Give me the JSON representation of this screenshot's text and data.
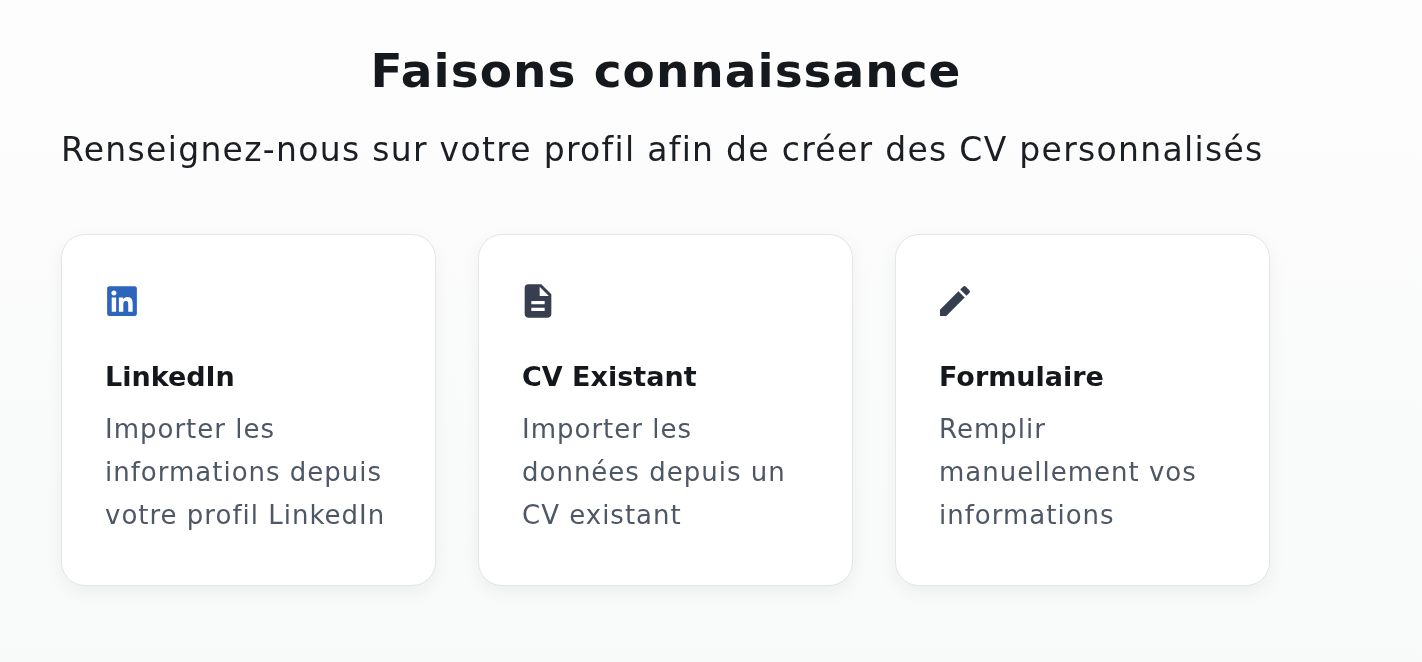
{
  "heading": {
    "title": "Faisons connaissance",
    "subtitle": "Renseignez-nous sur votre profil afin de créer des CV personnalisés"
  },
  "options": [
    {
      "kind": "linkedin",
      "title": "LinkedIn",
      "description": "Importer les informations depuis votre profil LinkedIn"
    },
    {
      "kind": "document",
      "title": "CV Existant",
      "description": "Importer les données depuis un CV existant"
    },
    {
      "kind": "pencil",
      "title": "Formulaire",
      "description": "Remplir manuellement vos informations"
    }
  ]
}
